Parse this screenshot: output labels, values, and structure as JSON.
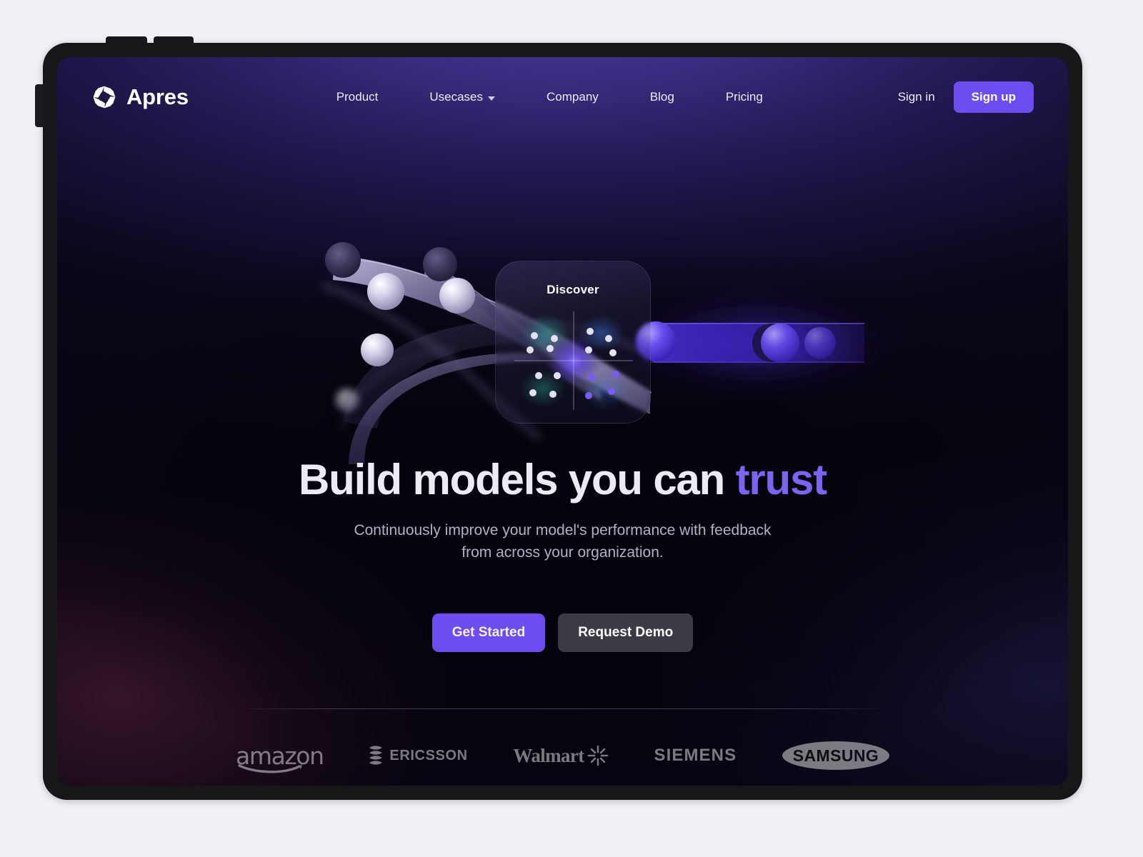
{
  "header": {
    "brand_name": "Apres",
    "brand_logo_icon": "apres-pinwheel-logo",
    "nav": [
      {
        "label": "Product",
        "has_dropdown": false
      },
      {
        "label": "Usecases",
        "has_dropdown": true
      },
      {
        "label": "Company",
        "has_dropdown": false
      },
      {
        "label": "Blog",
        "has_dropdown": false
      },
      {
        "label": "Pricing",
        "has_dropdown": false
      }
    ],
    "signin_label": "Sign in",
    "signup_label": "Sign up"
  },
  "hero": {
    "headline_main": "Build models you can ",
    "headline_accent": "trust",
    "subtitle_line1": "Continuously improve your model's performance with feedback",
    "subtitle_line2": "from across your organization.",
    "cta_primary": "Get Started",
    "cta_secondary": "Request Demo"
  },
  "illustration": {
    "card_title": "Discover",
    "card_icon": "scatter-plot-quadrant-chart"
  },
  "logo_strip": {
    "logos": [
      {
        "name": "amazon",
        "text": "amazon"
      },
      {
        "name": "ericsson",
        "text": "ERICSSON"
      },
      {
        "name": "walmart",
        "text": "Walmart"
      },
      {
        "name": "siemens",
        "text": "SIEMENS"
      },
      {
        "name": "samsung",
        "text": "SAMSUNG"
      }
    ]
  },
  "colors": {
    "accent_purple": "#6d4df0",
    "headline_accent": "#7c63f2",
    "secondary_button": "#3b3b44",
    "page_background": "#f0f1f5",
    "device_frame": "#17171a",
    "screen_dark": "#08060f",
    "text_primary": "#eceaf5",
    "text_muted": "#b4afc6"
  }
}
